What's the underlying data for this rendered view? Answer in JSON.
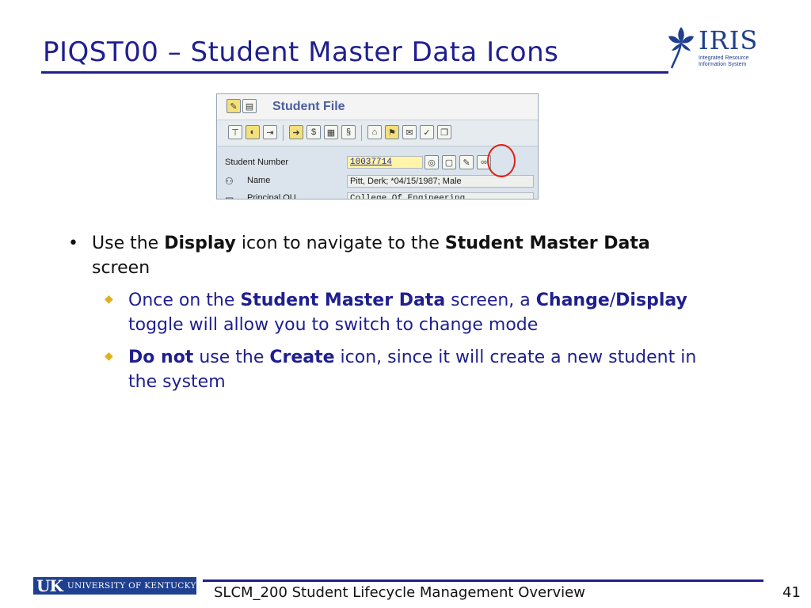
{
  "slide": {
    "title": "PIQST00 – Student Master Data Icons",
    "logo": {
      "name": "IRIS",
      "subtitle_line1": "Integrated Resource",
      "subtitle_line2": "Information System"
    },
    "sap_screen": {
      "window_title": "Student File",
      "fields": {
        "student_number_label": "Student Number",
        "student_number_value": "10037714",
        "name_label": "Name",
        "name_value": "Pitt, Derk; *04/15/1987; Male",
        "principal_ou_label": "Principal OU",
        "principal_ou_value": "College Of Engineering"
      }
    },
    "bullets": {
      "b1_pre": "Use the ",
      "b1_bold1": "Display",
      "b1_mid": " icon to navigate to the ",
      "b1_bold2": "Student Master Data",
      "b1_post": " screen",
      "b2_pre": "Once on the ",
      "b2_bold1": "Student Master Data",
      "b2_mid1": " screen, a ",
      "b2_bold2": "Change",
      "b2_slash": "/",
      "b2_bold3": "Display",
      "b2_post": " toggle will allow you to switch to change mode",
      "b3_bold1": "Do not",
      "b3_mid": " use the ",
      "b3_bold2": "Create",
      "b3_post": " icon, since it will create a new student in the system"
    },
    "footer": {
      "university": "UNIVERSITY OF KENTUCKY",
      "uk_mark": "UK",
      "course": "SLCM_200 Student Lifecycle Management Overview",
      "page": "41"
    }
  },
  "colors": {
    "title_blue": "#1f1f8f",
    "highlight_red": "#e0201a",
    "bullet_gold": "#e0b020"
  }
}
